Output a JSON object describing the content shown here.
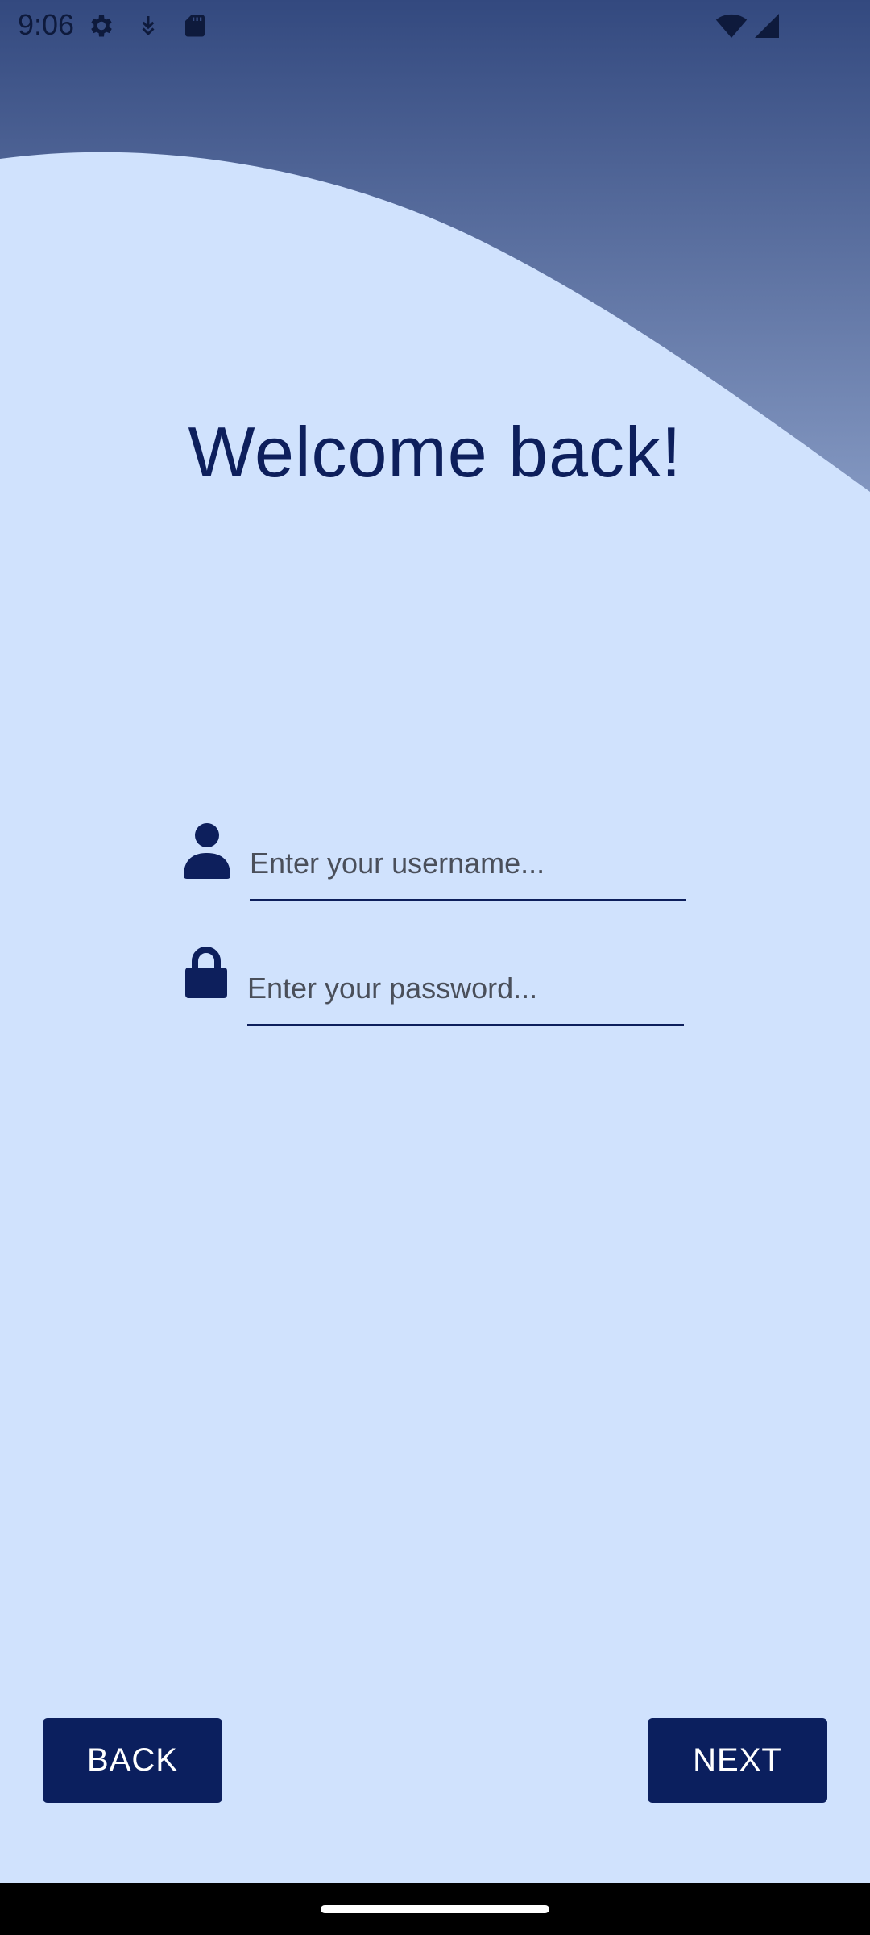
{
  "status_bar": {
    "time": "9:06",
    "icons": [
      "gear-icon",
      "download-icon",
      "sd-card-icon",
      "wifi-icon",
      "signal-icon"
    ]
  },
  "colors": {
    "background": "#d0e2fd",
    "accent": "#0b1f5e",
    "header_gradient_top": "#33497f",
    "header_gradient_bottom": "#8296c0"
  },
  "login": {
    "title": "Welcome back!",
    "username": {
      "icon": "user-icon",
      "placeholder": "Enter your username...",
      "value": ""
    },
    "password": {
      "icon": "lock-icon",
      "placeholder": "Enter your password...",
      "value": ""
    }
  },
  "actions": {
    "back_label": "BACK",
    "next_label": "NEXT"
  }
}
